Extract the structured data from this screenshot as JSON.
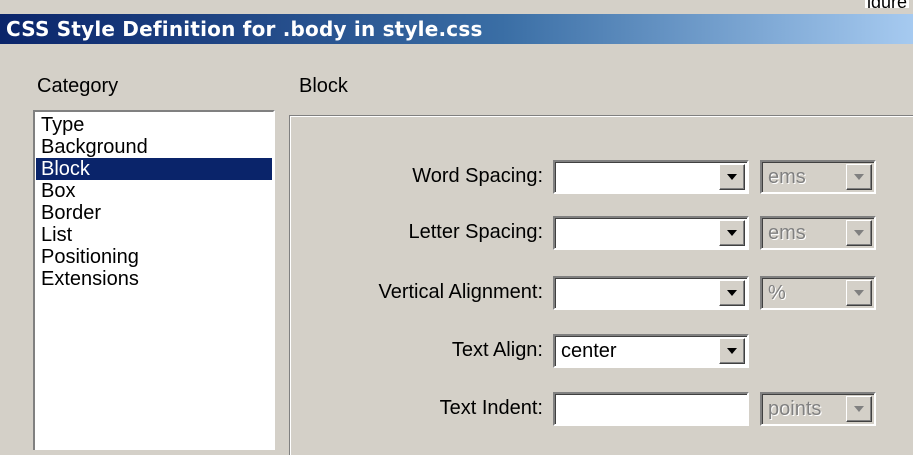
{
  "corner_text": "igure",
  "window": {
    "title": "CSS Style Definition for .body in style.css"
  },
  "category": {
    "header": "Category",
    "items": [
      {
        "label": "Type",
        "selected": false
      },
      {
        "label": "Background",
        "selected": false
      },
      {
        "label": "Block",
        "selected": true
      },
      {
        "label": "Box",
        "selected": false
      },
      {
        "label": "Border",
        "selected": false
      },
      {
        "label": "List",
        "selected": false
      },
      {
        "label": "Positioning",
        "selected": false
      },
      {
        "label": "Extensions",
        "selected": false
      }
    ]
  },
  "panel": {
    "header": "Block",
    "fields": {
      "word_spacing": {
        "label": "Word Spacing:",
        "value": "",
        "unit": "ems"
      },
      "letter_spacing": {
        "label": "Letter Spacing:",
        "value": "",
        "unit": "ems"
      },
      "vertical_alignment": {
        "label": "Vertical Alignment:",
        "value": "",
        "unit": "%"
      },
      "text_align": {
        "label": "Text Align:",
        "value": "center"
      },
      "text_indent": {
        "label": "Text Indent:",
        "value": "",
        "unit": "points"
      }
    }
  },
  "colors": {
    "selection": "#0a246a",
    "dialog_face": "#d4d0c8",
    "titlebar_start": "#0a246a",
    "titlebar_end": "#a6caf0"
  },
  "icons": {
    "dropdown": "chevron-down-icon"
  }
}
